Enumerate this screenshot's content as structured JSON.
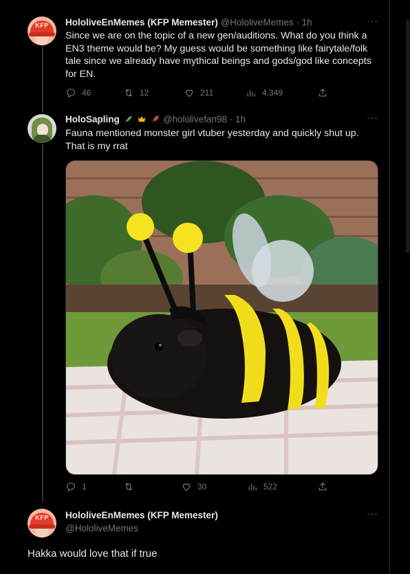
{
  "tweets": [
    {
      "name": "HololiveEnMemes (KFP Memester)",
      "handle": "@HololiveMemes",
      "time": "· 1h",
      "text": "Since we are on the topic of a new gen/auditions. What do you think a EN3 theme would be? My guess would be something like fairytale/folk tale since we already have mythical beings and gods/god like concepts for EN.",
      "stats": {
        "replies": "46",
        "reposts": "12",
        "likes": "211",
        "views": "4,349"
      },
      "avatar_text": "KFP"
    },
    {
      "name": "HoloSapling",
      "handle": "@hololivefan98",
      "time": "· 1h",
      "text": "Fauna mentioned monster girl vtuber yesterday and quickly shut up. That is my rrat",
      "stats": {
        "replies": "1",
        "reposts": "",
        "likes": "30",
        "views": "522"
      },
      "media_alt": "guinea pig in a bee costume"
    },
    {
      "name": "HololiveEnMemes (KFP Memester)",
      "handle": "@HololiveMemes",
      "text": "Hakka would love that if true",
      "avatar_text": "KFP"
    }
  ],
  "icons": [
    "reply-icon",
    "repost-icon",
    "like-icon",
    "views-icon",
    "share-icon",
    "more-icon"
  ],
  "colors": {
    "background": "#000000",
    "text": "#e7e9ea",
    "muted": "#71767b",
    "bee_yellow": "#f2dd1c"
  }
}
